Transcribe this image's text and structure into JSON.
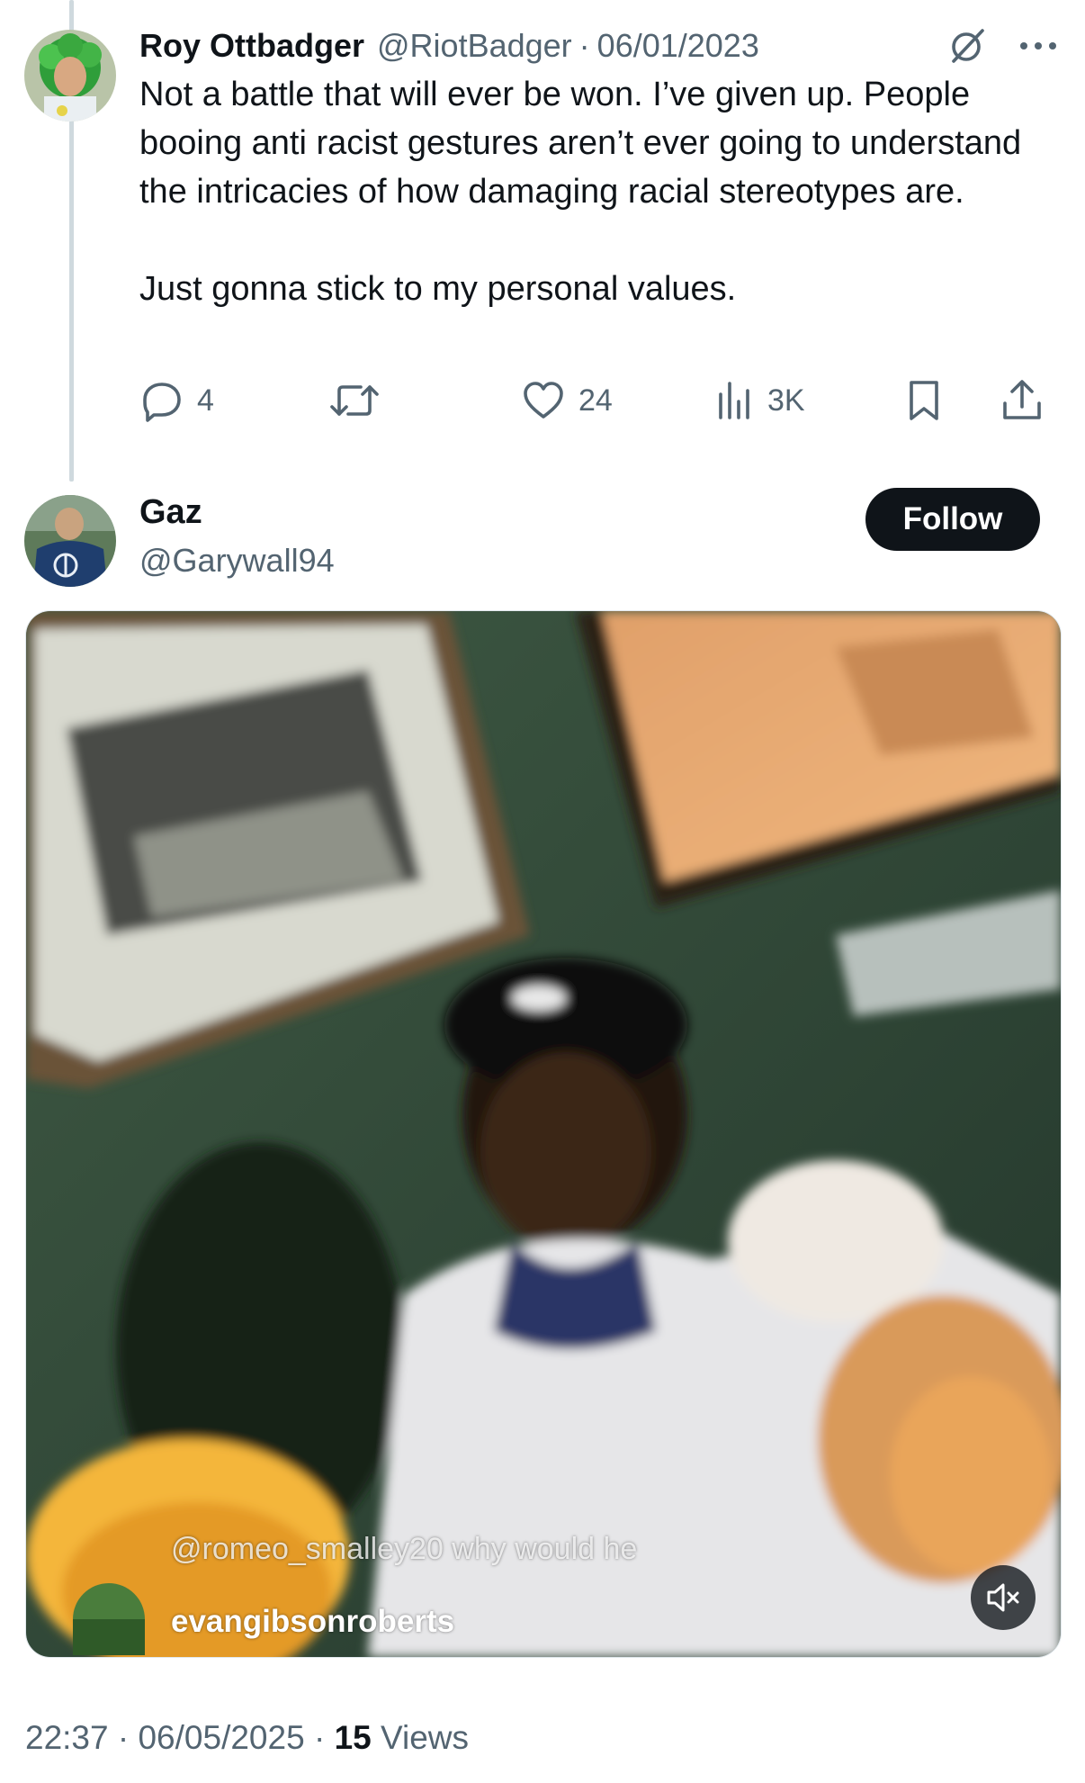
{
  "reply_tweet": {
    "display_name": "Roy Ottbadger",
    "handle": "@RiotBadger",
    "separator": "·",
    "date": "06/01/2023",
    "text": "Not a battle that will ever be won. I’ve given up. People booing anti racist gestures aren’t ever going to understand the intricacies of how damaging racial stereotypes are.\n\nJust gonna stick to my personal values.",
    "actions": {
      "replies": "4",
      "retweets": "",
      "likes": "24",
      "views": "3K"
    },
    "icons": [
      "grok-icon",
      "more-icon",
      "reply-icon",
      "retweet-icon",
      "like-icon",
      "views-icon",
      "bookmark-icon",
      "share-icon"
    ]
  },
  "main_tweet": {
    "display_name": "Gaz",
    "handle": "@Garywall94",
    "follow_label": "Follow",
    "video_overlay": {
      "comment_text": "@romeo_smalley20 why would he",
      "username": "evangibsonroberts"
    },
    "timestamp": "22:37",
    "date": "06/05/2025",
    "sep": "·",
    "views_count": "15",
    "views_label": "Views"
  },
  "colors": {
    "primary_text": "#0f1419",
    "secondary_text": "#536471",
    "thread_line": "#cfd9de",
    "follow_bg": "#0f1419",
    "follow_text": "#ffffff"
  }
}
